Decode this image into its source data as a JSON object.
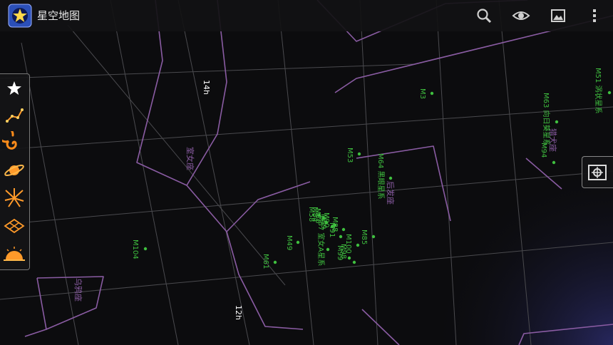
{
  "app": {
    "title": "星空地图",
    "icon": "star-map-app-icon"
  },
  "toolbar": [
    {
      "name": "search-button",
      "icon": "magnifier-icon"
    },
    {
      "name": "view-button",
      "icon": "eye-icon"
    },
    {
      "name": "gallery-button",
      "icon": "image-icon"
    },
    {
      "name": "overflow-menu-button",
      "icon": "more-vertical-icon"
    }
  ],
  "layers": [
    {
      "name": "layer-stars-toggle",
      "icon": "star-icon"
    },
    {
      "name": "layer-constellations-toggle",
      "icon": "constellation-icon"
    },
    {
      "name": "layer-messier-toggle",
      "icon": "galaxy-icon"
    },
    {
      "name": "layer-planets-toggle",
      "icon": "planet-icon"
    },
    {
      "name": "layer-meteor-toggle",
      "icon": "meteor-shower-icon"
    },
    {
      "name": "layer-grid-toggle",
      "icon": "grid-icon"
    },
    {
      "name": "layer-horizon-toggle",
      "icon": "horizon-icon"
    }
  ],
  "manual_mode_button": {
    "icon": "manual-mode-icon"
  },
  "colors": {
    "constellation": "#8a5ca3",
    "object_label": "#3fbf3f",
    "grid": "#4a4a4e",
    "label_text": "#ffffff"
  },
  "sky": {
    "ra_labels": [
      "14h",
      "12h"
    ],
    "constellations": [
      "室女座",
      "后发座",
      "猎犬座",
      "乌鸦座"
    ],
    "objects": [
      {
        "id": "M3",
        "label": "M3"
      },
      {
        "id": "M53",
        "label": "M53"
      },
      {
        "id": "M64",
        "label": "M64 黑眼星系"
      },
      {
        "id": "M63",
        "label": "M63 向日葵星系"
      },
      {
        "id": "M94",
        "label": "M94"
      },
      {
        "id": "M51",
        "label": "M51 涡状星系"
      },
      {
        "id": "M85",
        "label": "M85"
      },
      {
        "id": "M100",
        "label": "M100"
      },
      {
        "id": "M98",
        "label": "M98"
      },
      {
        "id": "M99",
        "label": "M99"
      },
      {
        "id": "M88",
        "label": "M88"
      },
      {
        "id": "M91",
        "label": "M91"
      },
      {
        "id": "M87",
        "label": "M87 室女A星系"
      },
      {
        "id": "M86",
        "label": "M86"
      },
      {
        "id": "M84",
        "label": "M84"
      },
      {
        "id": "M89",
        "label": "M89"
      },
      {
        "id": "M90",
        "label": "M90"
      },
      {
        "id": "M58",
        "label": "M58"
      },
      {
        "id": "M49",
        "label": "M49"
      },
      {
        "id": "M61",
        "label": "M61"
      },
      {
        "id": "M104",
        "label": "M104"
      }
    ]
  }
}
